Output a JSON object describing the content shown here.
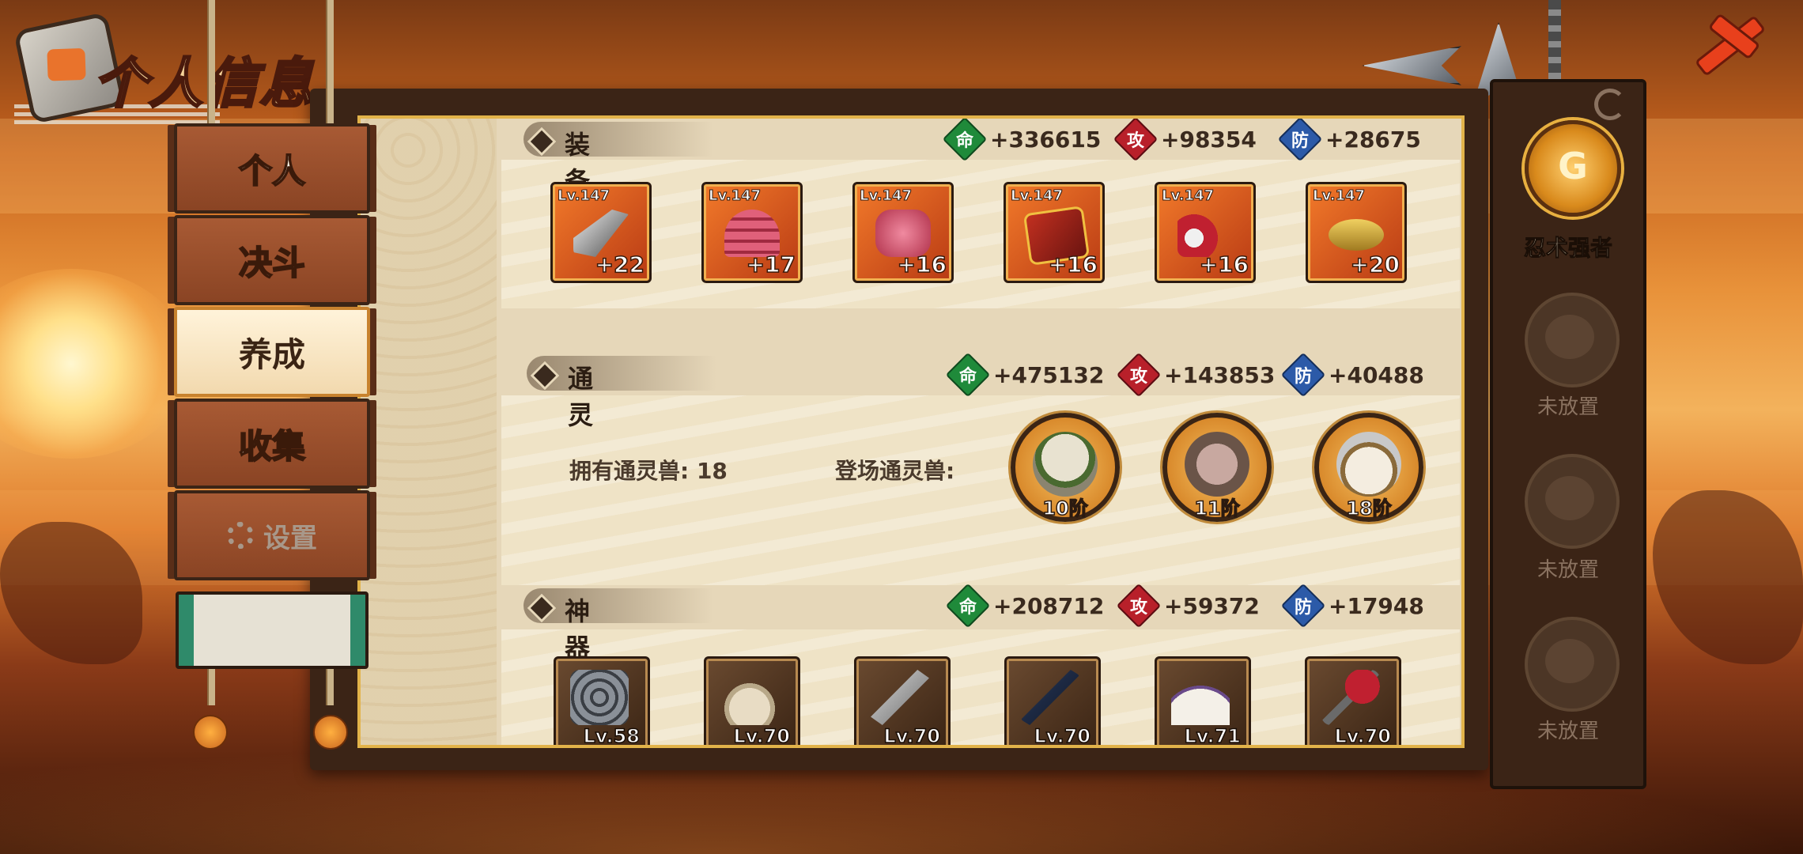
{
  "header": {
    "title": "个人信息"
  },
  "menu": {
    "items": [
      {
        "label": "个人",
        "state": "normal"
      },
      {
        "label": "决斗",
        "state": "normal"
      },
      {
        "label": "养成",
        "state": "active"
      },
      {
        "label": "收集",
        "state": "normal"
      },
      {
        "label": "设置",
        "state": "disabled",
        "icon": "gear-icon"
      }
    ]
  },
  "sections": {
    "equipment": {
      "title": "装备",
      "stats": {
        "hp": "+336615",
        "atk": "+98354",
        "def": "+28675"
      },
      "items": [
        {
          "level": "Lv.147",
          "bonus": "+22",
          "icon": "blade-icon"
        },
        {
          "level": "Lv.147",
          "bonus": "+17",
          "icon": "helmet-icon"
        },
        {
          "level": "Lv.147",
          "bonus": "+16",
          "icon": "armor-icon"
        },
        {
          "level": "Lv.147",
          "bonus": "+16",
          "icon": "scroll-book-icon"
        },
        {
          "level": "Lv.147",
          "bonus": "+16",
          "icon": "claw-icon"
        },
        {
          "level": "Lv.147",
          "bonus": "+20",
          "icon": "headband-icon"
        }
      ]
    },
    "summon": {
      "title": "通灵",
      "stats": {
        "hp": "+475132",
        "atk": "+143853",
        "def": "+40488"
      },
      "owned_label": "拥有通灵兽: 18",
      "deployed_label": "登场通灵兽:",
      "beasts": [
        {
          "rank": "10阶",
          "icon": "dog-beast-icon"
        },
        {
          "rank": "11阶",
          "icon": "slug-beast-icon"
        },
        {
          "rank": "18阶",
          "icon": "monkey-beast-icon"
        }
      ]
    },
    "artifact": {
      "title": "神器",
      "stats": {
        "hp": "+208712",
        "atk": "+59372",
        "def": "+17948"
      },
      "items": [
        {
          "level": "Lv.58",
          "icon": "chain-artifact-icon"
        },
        {
          "level": "Lv.70",
          "icon": "gourd-artifact-icon"
        },
        {
          "level": "Lv.70",
          "icon": "sword-artifact-icon"
        },
        {
          "level": "Lv.70",
          "icon": "flute-artifact-icon"
        },
        {
          "level": "Lv.71",
          "icon": "fan-artifact-icon"
        },
        {
          "level": "Lv.70",
          "icon": "scythe-artifact-icon"
        }
      ]
    }
  },
  "stat_icons": {
    "hp": "命",
    "atk": "攻",
    "def": "防"
  },
  "right_panel": {
    "emblem_label": "忍术强者",
    "slots": [
      {
        "label": "未放置"
      },
      {
        "label": "未放置"
      },
      {
        "label": "未放置"
      }
    ]
  },
  "colors": {
    "hp": "#1f8a3a",
    "atk": "#b8202a",
    "def": "#2c5aa8",
    "accent": "#e2b34a"
  }
}
